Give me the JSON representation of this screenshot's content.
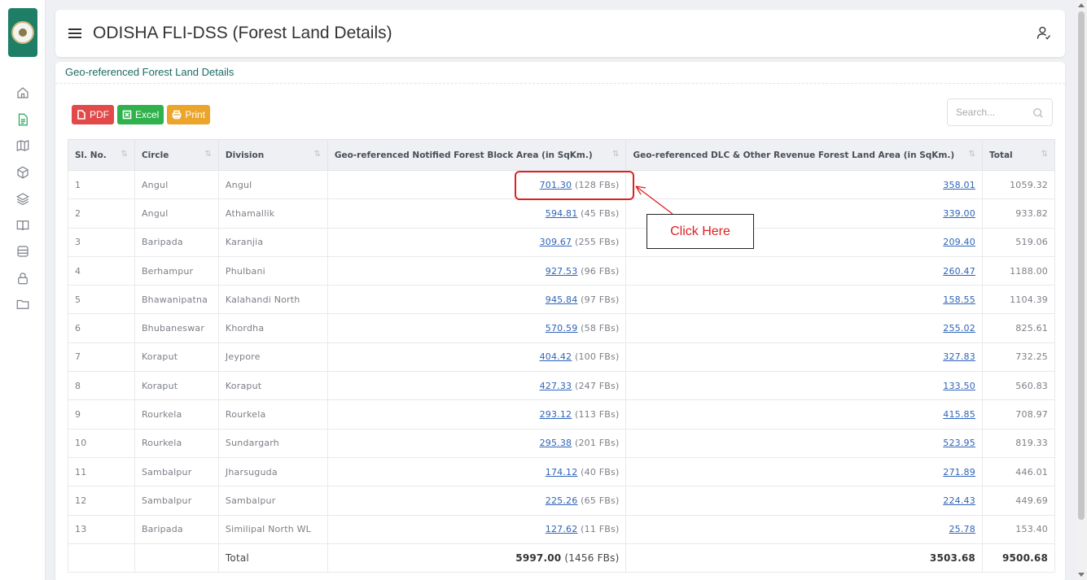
{
  "header": {
    "title": "ODISHA FLI-DSS (Forest Land Details)"
  },
  "sidebar": {
    "icons": [
      "home-icon",
      "document-icon",
      "map-icon",
      "cube-icon",
      "layers-icon",
      "book-icon",
      "database-icon",
      "lock-icon",
      "folder-icon"
    ],
    "active": "document-icon"
  },
  "card": {
    "title": "Geo-referenced Forest Land Details"
  },
  "toolbar": {
    "pdf_label": "PDF",
    "excel_label": "Excel",
    "print_label": "Print"
  },
  "search": {
    "placeholder": "Search..."
  },
  "table": {
    "headers": [
      "Sl. No.",
      "Circle",
      "Division",
      "Geo-referenced Notified Forest Block Area (in SqKm.)",
      "Geo-referenced DLC & Other Revenue Forest Land Area (in SqKm.)",
      "Total"
    ],
    "rows": [
      {
        "sl": "1",
        "circle": "Angul",
        "division": "Angul",
        "nfb": "701.30",
        "fbs": "(128 FBs)",
        "dlc": "358.01",
        "total": "1059.32"
      },
      {
        "sl": "2",
        "circle": "Angul",
        "division": "Athamallik",
        "nfb": "594.81",
        "fbs": "(45 FBs)",
        "dlc": "339.00",
        "total": "933.82"
      },
      {
        "sl": "3",
        "circle": "Baripada",
        "division": "Karanjia",
        "nfb": "309.67",
        "fbs": "(255 FBs)",
        "dlc": "209.40",
        "total": "519.06"
      },
      {
        "sl": "4",
        "circle": "Berhampur",
        "division": "Phulbani",
        "nfb": "927.53",
        "fbs": "(96 FBs)",
        "dlc": "260.47",
        "total": "1188.00"
      },
      {
        "sl": "5",
        "circle": "Bhawanipatna",
        "division": "Kalahandi North",
        "nfb": "945.84",
        "fbs": "(97 FBs)",
        "dlc": "158.55",
        "total": "1104.39"
      },
      {
        "sl": "6",
        "circle": "Bhubaneswar",
        "division": "Khordha",
        "nfb": "570.59",
        "fbs": "(58 FBs)",
        "dlc": "255.02",
        "total": "825.61"
      },
      {
        "sl": "7",
        "circle": "Koraput",
        "division": "Jeypore",
        "nfb": "404.42",
        "fbs": "(100 FBs)",
        "dlc": "327.83",
        "total": "732.25"
      },
      {
        "sl": "8",
        "circle": "Koraput",
        "division": "Koraput",
        "nfb": "427.33",
        "fbs": "(247 FBs)",
        "dlc": "133.50",
        "total": "560.83"
      },
      {
        "sl": "9",
        "circle": "Rourkela",
        "division": "Rourkela",
        "nfb": "293.12",
        "fbs": "(113 FBs)",
        "dlc": "415.85",
        "total": "708.97"
      },
      {
        "sl": "10",
        "circle": "Rourkela",
        "division": "Sundargarh",
        "nfb": "295.38",
        "fbs": "(201 FBs)",
        "dlc": "523.95",
        "total": "819.33"
      },
      {
        "sl": "11",
        "circle": "Sambalpur",
        "division": "Jharsuguda",
        "nfb": "174.12",
        "fbs": "(40 FBs)",
        "dlc": "271.89",
        "total": "446.01"
      },
      {
        "sl": "12",
        "circle": "Sambalpur",
        "division": "Sambalpur",
        "nfb": "225.26",
        "fbs": "(65 FBs)",
        "dlc": "224.43",
        "total": "449.69"
      },
      {
        "sl": "13",
        "circle": "Baripada",
        "division": "Similipal North WL",
        "nfb": "127.62",
        "fbs": "(11 FBs)",
        "dlc": "25.78",
        "total": "153.40"
      }
    ],
    "total_row": {
      "label": "Total",
      "nfb": "5997.00",
      "fbs": "(1456 FBs)",
      "dlc": "3503.68",
      "total": "9500.68"
    }
  },
  "annotation": {
    "callout_text": "Click Here",
    "color": "#e02020"
  },
  "colors": {
    "brand_green": "#1e7e66",
    "link_blue": "#2f63b8",
    "pdf_red": "#e24a4a",
    "excel_green": "#2fb24c",
    "print_orange": "#eaa52a"
  }
}
